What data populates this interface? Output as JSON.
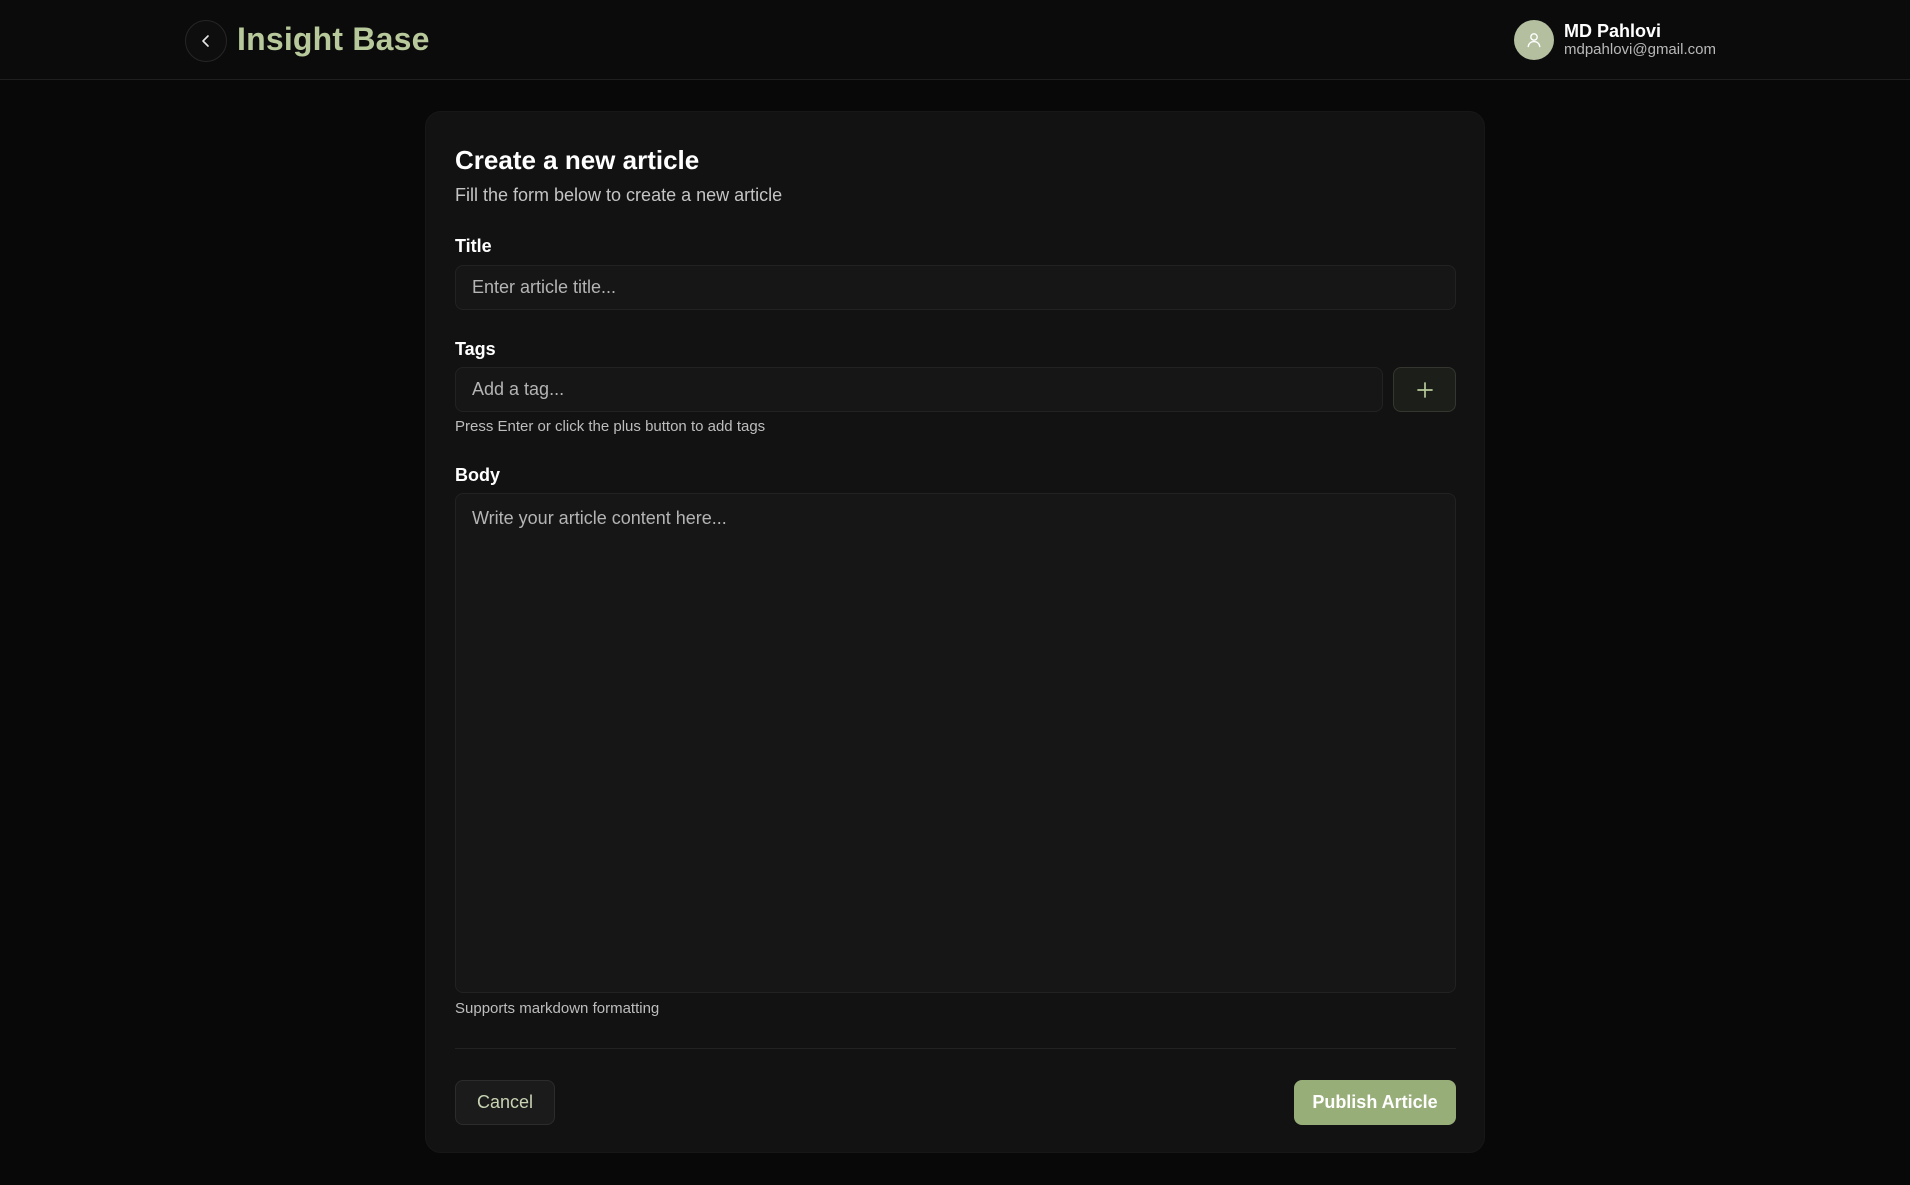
{
  "header": {
    "brand": "Insight Base",
    "user": {
      "name": "MD Pahlovi",
      "email": "mdpahlovi@gmail.com"
    }
  },
  "form": {
    "title": "Create a new article",
    "subtitle": "Fill the form below to create a new article",
    "title_field": {
      "label": "Title",
      "placeholder": "Enter article title...",
      "value": ""
    },
    "tags_field": {
      "label": "Tags",
      "placeholder": "Add a tag...",
      "value": "",
      "hint": "Press Enter or click the plus button to add tags"
    },
    "body_field": {
      "label": "Body",
      "placeholder": "Write your article content here...",
      "value": "",
      "hint": "Supports markdown formatting"
    },
    "actions": {
      "cancel": "Cancel",
      "publish": "Publish Article"
    }
  },
  "icons": {
    "back": "chevron-left-icon",
    "avatar": "user-icon",
    "add_tag": "plus-icon"
  },
  "colors": {
    "accent": "#98ae79",
    "brand": "#b7c99a",
    "background": "#080808",
    "card": "#121212"
  }
}
